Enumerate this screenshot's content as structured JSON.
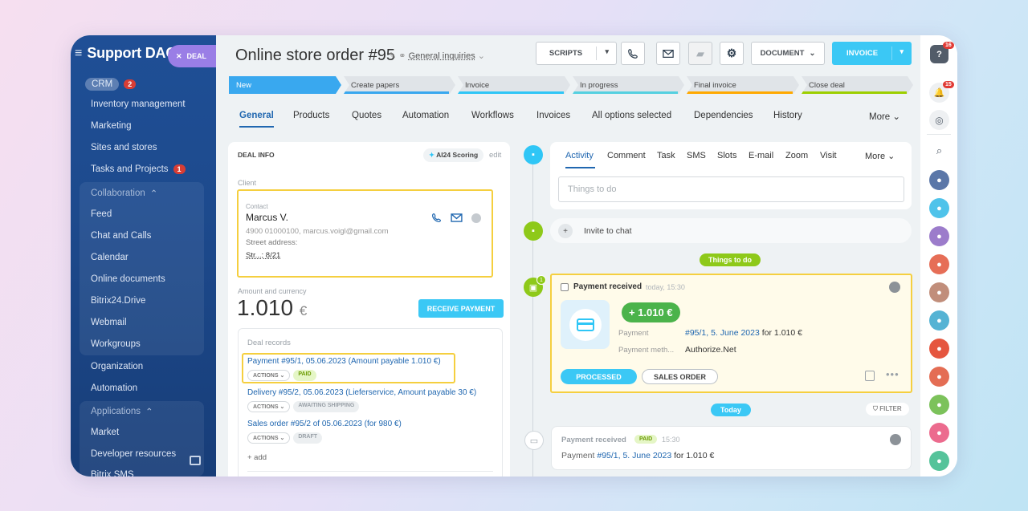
{
  "sidebar": {
    "title": "Support DAO",
    "deal_pill": "DEAL",
    "crm": "CRM",
    "crm_count": "2",
    "items": [
      "Inventory management",
      "Marketing",
      "Sites and stores",
      "Tasks and Projects"
    ],
    "tasks_count": "1",
    "collab_label": "Collaboration",
    "collab_items": [
      "Feed",
      "Chat and Calls",
      "Calendar",
      "Online documents",
      "Bitrix24.Drive",
      "Webmail",
      "Workgroups"
    ],
    "org_items": [
      "Organization",
      "Automation"
    ],
    "apps_label": "Applications",
    "apps_items": [
      "Market",
      "Developer resources"
    ],
    "cut_item": "Bitrix SMS"
  },
  "header": {
    "title": "Online store order #95",
    "category": "General inquiries",
    "scripts": "SCRIPTS",
    "document": "DOCUMENT",
    "invoice": "INVOICE"
  },
  "stages": [
    {
      "label": "New",
      "color": "#39a8ef"
    },
    {
      "label": "Create papers",
      "color": "#39a8ef"
    },
    {
      "label": "Invoice",
      "color": "#2fc6f6"
    },
    {
      "label": "In progress",
      "color": "#55d0e0"
    },
    {
      "label": "Final invoice",
      "color": "#ffa900"
    },
    {
      "label": "Close deal",
      "color": "#9dcf00"
    }
  ],
  "tabs": [
    "General",
    "Products",
    "Quotes",
    "Automation",
    "Workflows",
    "Invoices",
    "All options selected",
    "Dependencies",
    "History",
    "More"
  ],
  "deal_info": {
    "heading": "DEAL INFO",
    "scoring": "AI24 Scoring",
    "edit": "edit",
    "client_label": "Client",
    "contact_label": "Contact",
    "contact_name": "Marcus V.",
    "contact_line": "4900 01000100, marcus.voigl@gmail.com",
    "address_label": "Street address:",
    "address": "Str...; 8/21",
    "amount_label": "Amount and currency",
    "amount": "1.010",
    "currency": "€",
    "receive_payment": "RECEIVE PAYMENT",
    "records_label": "Deal records",
    "records": [
      {
        "title": "Payment #95/1, 05.06.2023 (Amount payable 1.010 €)",
        "actions": "ACTIONS",
        "status": "PAID"
      },
      {
        "title": "Delivery #95/2, 05.06.2023 (Lieferservice, Amount payable 30 €)",
        "actions": "ACTIONS",
        "status": "AWAITING SHIPPING"
      },
      {
        "title": "Sales order #95/2 of 05.06.2023 (for 980 €)",
        "actions": "ACTIONS",
        "status": "DRAFT"
      }
    ],
    "add": "+ add"
  },
  "activity": {
    "tabs": [
      "Activity",
      "Comment",
      "Task",
      "SMS",
      "Slots",
      "E-mail",
      "Zoom",
      "Visit",
      "More"
    ],
    "placeholder": "Things to do",
    "invite": "Invite to chat",
    "things_pill": "Things to do",
    "payment_card": {
      "badge": "1",
      "title": "Payment received",
      "time": "today, 15:30",
      "amount": "+ 1.010 €",
      "payment_label": "Payment",
      "payment_value": "#95/1, 5. June 2023",
      "payment_suffix": "for 1.010 €",
      "method_label": "Payment meth...",
      "method_value": "Authorize.Net",
      "processed": "PROCESSED",
      "sales_order": "SALES ORDER"
    },
    "today_pill": "Today",
    "filter": "FILTER",
    "history": {
      "title": "Payment received",
      "tag": "PAID",
      "time": "15:30",
      "prefix": "Payment",
      "link": "#95/1, 5. June 2023",
      "suffix": "for 1.010 €"
    }
  },
  "rail": {
    "help_badge": "16",
    "bell_badge": "15"
  }
}
